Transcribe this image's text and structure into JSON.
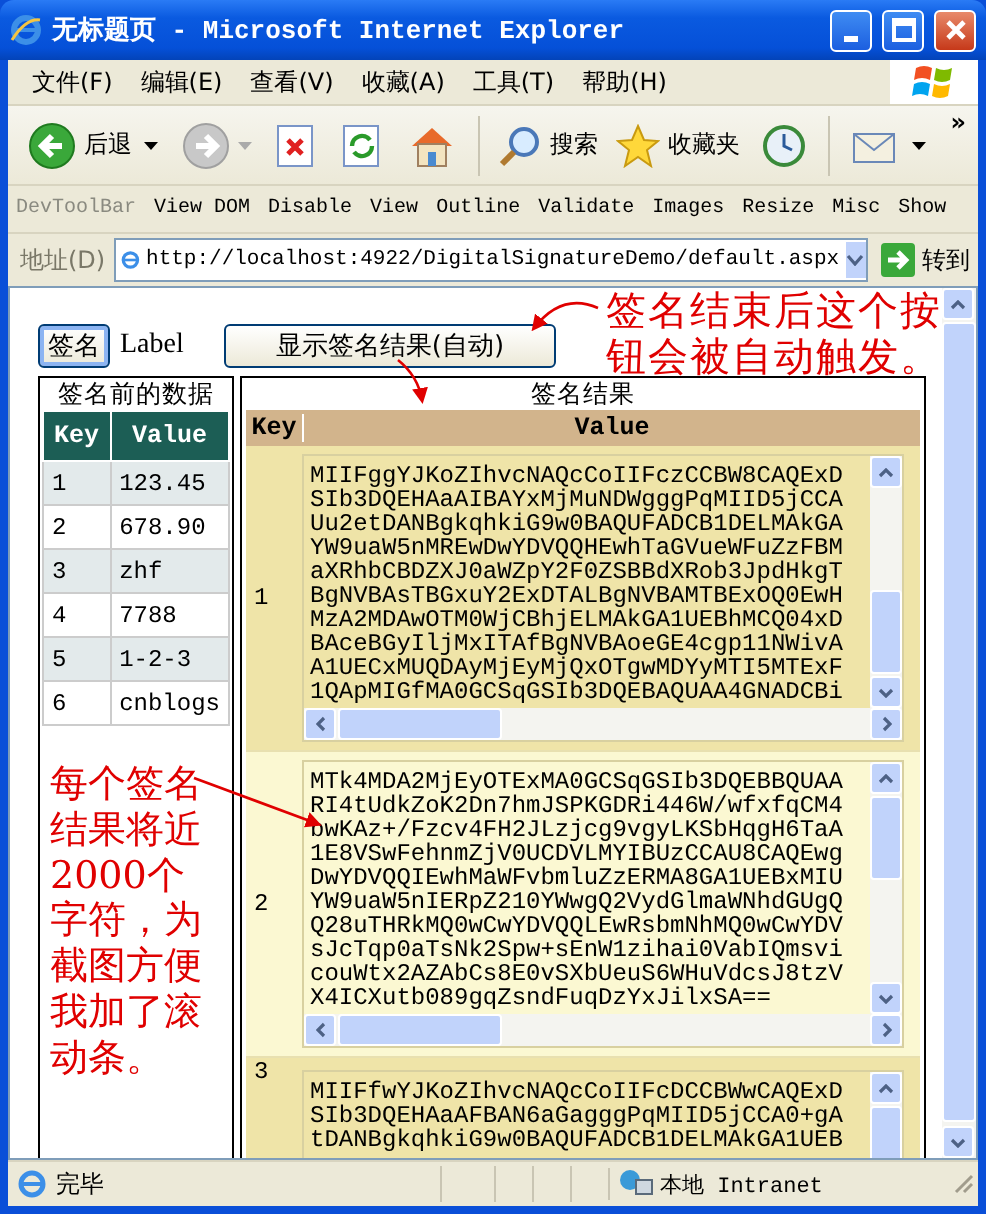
{
  "window": {
    "title": "无标题页 - Microsoft Internet Explorer"
  },
  "menu": [
    "文件(F)",
    "编辑(E)",
    "查看(V)",
    "收藏(A)",
    "工具(T)",
    "帮助(H)"
  ],
  "toolbar": {
    "back": "后退",
    "search": "搜索",
    "favorites": "收藏夹",
    "more": "»"
  },
  "dev_toolbar": {
    "title": "DevToolBar",
    "items": [
      "View DOM",
      "Disable",
      "View",
      "Outline",
      "Validate",
      "Images",
      "Resize",
      "Misc",
      "Show"
    ]
  },
  "address_bar": {
    "label": "地址(D)",
    "url": "http://localhost:4922/DigitalSignatureDemo/default.aspx",
    "go": "转到"
  },
  "page": {
    "sign_button": "签名",
    "label": "Label",
    "show_button": "显示签名结果(自动)",
    "annotation_top": "签名结束后这个按钮会被自动触发。",
    "annotation_side": "每个签名结果将近2000个字符，为截图方便我加了滚动条。",
    "data_table": {
      "title": "签名前的数据",
      "columns": [
        "Key",
        "Value"
      ],
      "rows": [
        {
          "key": "1",
          "value": "123.45"
        },
        {
          "key": "2",
          "value": "678.90"
        },
        {
          "key": "3",
          "value": "zhf"
        },
        {
          "key": "4",
          "value": "7788"
        },
        {
          "key": "5",
          "value": "1-2-3"
        },
        {
          "key": "6",
          "value": "cnblogs"
        }
      ]
    },
    "result_table": {
      "title": "签名结果",
      "columns": [
        "Key",
        "Value"
      ],
      "rows": [
        {
          "key": "1",
          "lines": [
            "MIIFggYJKoZIhvcNAQcCoIIFczCCBW8CAQExD",
            "SIb3DQEHAaAIBAYxMjMuNDWgggPqMIID5jCCA",
            "Uu2etDANBgkqhkiG9w0BAQUFADCB1DELMAkGA",
            "YW9uaW5nMREwDwYDVQQHEwhTaGVueWFuZzFBM",
            "aXRhbCBDZXJ0aWZpY2F0ZSBBdXRob3JpdHkgT",
            "BgNVBAsTBGxuY2ExDTALBgNVBAMTBExOQ0EwH",
            "MzA2MDAwOTM0WjCBhjELMAkGA1UEBhMCQ04xD",
            "BAceBGyIljMxITAfBgNVBAoeGE4cgp11NWivA",
            "A1UECxMUQDAyMjEyMjQxOTgwMDYyMTI5MTExF",
            "1QApMIGfMA0GCSqGSIb3DQEBAQUAA4GNADCBi"
          ]
        },
        {
          "key": "2",
          "lines": [
            "MTk4MDA2MjEyOTExMA0GCSqGSIb3DQEBBQUAA",
            "RI4tUdkZoK2Dn7hmJSPKGDRi446W/wfxfqCM4",
            "bwKAz+/Fzcv4FH2JLzjcg9vgyLKSbHqgH6TaA",
            "1E8VSwFehnmZjV0UCDVLMYIBUzCCAU8CAQEwg",
            "DwYDVQQIEwhMaWFvbmluZzERMA8GA1UEBxMIU",
            "YW9uaW5nIERpZ210YWwgQ2VydGlmaWNhdGUgQ",
            "Q28uTHRkMQ0wCwYDVQQLEwRsbmNhMQ0wCwYDV",
            "sJcTqp0aTsNk2Spw+sEnW1zihai0VabIQmsvi",
            "couWtx2AZAbCs8E0vSXbUeuS6WHuVdcsJ8tzV",
            "X4ICXutb089gqZsndFuqDzYxJilxSA=="
          ]
        },
        {
          "key": "3",
          "lines": [
            "MIIFfwYJKoZIhvcNAQcCoIIFcDCCBWwCAQExD",
            "SIb3DQEHAaAFBAN6aGagggPqMIID5jCCA0+gA",
            "tDANBgkqhkiG9w0BAQUFADCB1DELMAkGA1UEB"
          ]
        }
      ]
    }
  },
  "status_bar": {
    "text": "完毕",
    "zone": "本地 Intranet"
  }
}
